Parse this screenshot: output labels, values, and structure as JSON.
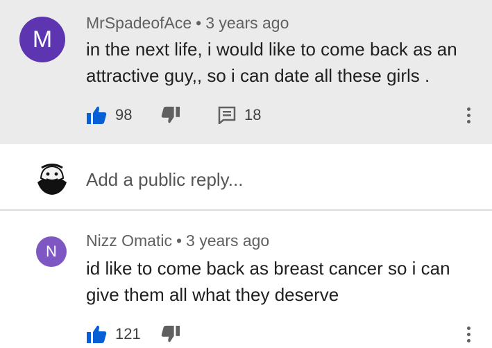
{
  "comments": [
    {
      "avatar_letter": "M",
      "author": "MrSpadeofAce",
      "separator": "•",
      "time": "3 years ago",
      "text": "in the next life, i would like to come back as an attractive guy,, so i can date all these girls .",
      "likes": "98",
      "replies": "18",
      "avatar_color": "#5e35b1"
    },
    {
      "avatar_letter": "N",
      "author": "Nizz Omatic",
      "separator": "•",
      "time": "3 years ago",
      "text": "id like to come back as breast cancer so i can give them all what they deserve",
      "likes": "121",
      "avatar_color": "#7e57c2"
    }
  ],
  "reply_box": {
    "placeholder": "Add a public reply..."
  },
  "colors": {
    "like_blue": "#065fd4",
    "icon_gray": "#606060",
    "highlight_bg": "#ebebeb"
  },
  "icons": [
    "thumb-up-icon",
    "thumb-down-icon",
    "comment-icon",
    "more-vert-icon"
  ]
}
